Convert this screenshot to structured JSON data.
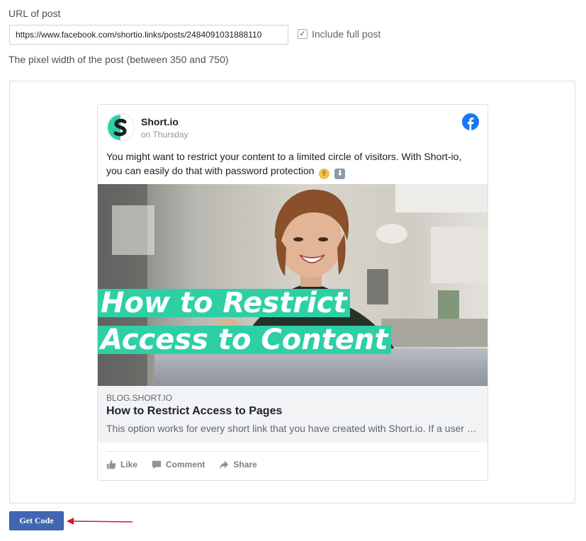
{
  "form": {
    "url_label": "URL of post",
    "url_value": "https://www.facebook.com/shortio.links/posts/2484091031888110",
    "include_full_post_label": "Include full post",
    "include_full_post_checked": true,
    "width_label": "The pixel width of the post (between 350 and 750)"
  },
  "post": {
    "page_name": "Short.io",
    "time": "on Thursday",
    "text": "You might want to restrict your content to a limited circle of visitors. With Short-io, you can easily do that with password protection",
    "image_headline_line1": "How to Restrict",
    "image_headline_line2": "Access to Content",
    "link_domain": "BLOG.SHORT.IO",
    "link_title": "How to Restrict Access to Pages",
    "link_description": "This option works for every short link that you have created with Short.io. If a user goes to a link protected by a password, they will see a form",
    "actions": {
      "like": "Like",
      "comment": "Comment",
      "share": "Share"
    }
  },
  "buttons": {
    "get_code": "Get Code"
  },
  "icons": {
    "avatar": "short-io-logo",
    "facebook": "facebook-logo-icon",
    "like": "thumbs-up-icon",
    "comment": "comment-bubble-icon",
    "share": "share-arrow-icon",
    "emoji1": "ok-hand-emoji",
    "emoji2": "down-arrow-emoji"
  },
  "colors": {
    "accent_button": "#4267b2",
    "facebook_blue": "#1877f2",
    "headline_band": "#2fcfa6",
    "annotation_arrow": "#e0141e"
  }
}
